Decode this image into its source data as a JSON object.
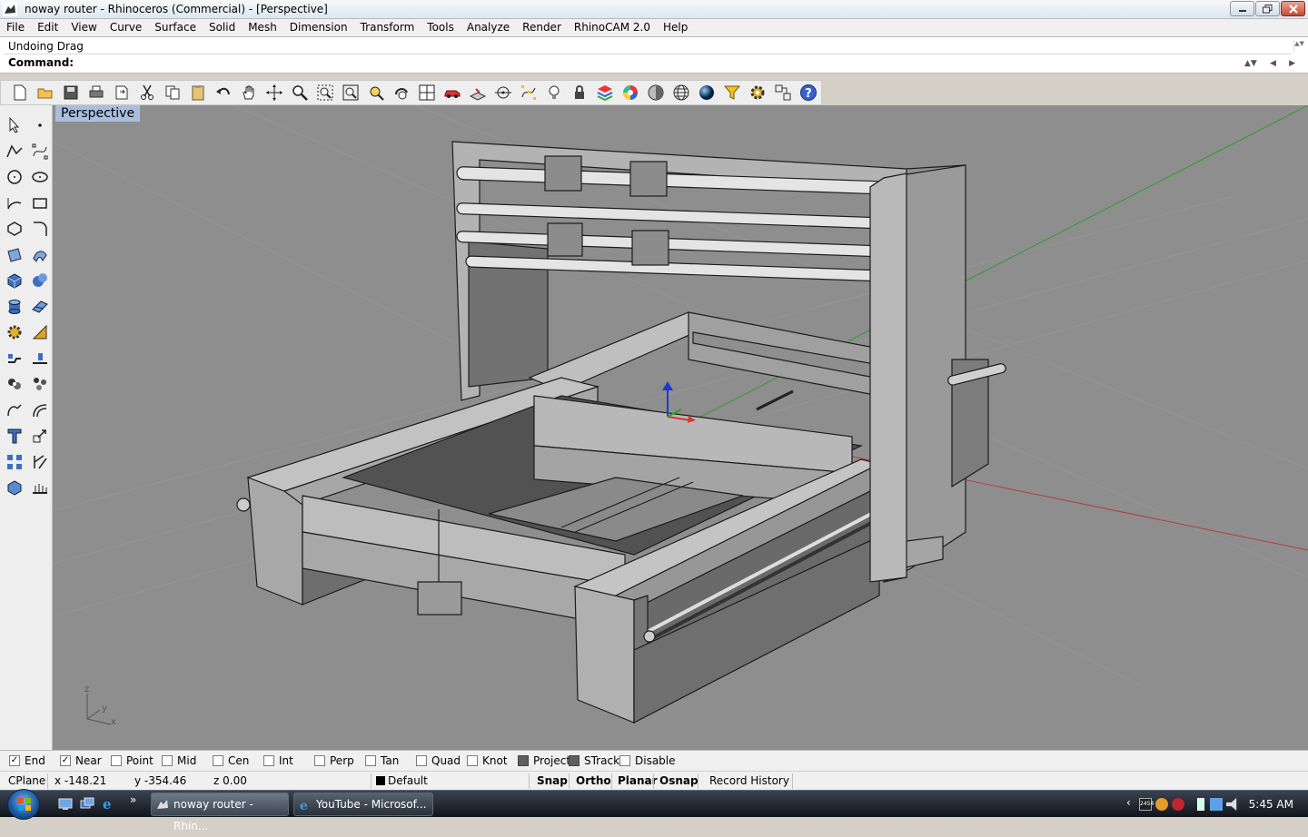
{
  "window": {
    "title": "noway router - Rhinoceros (Commercial) - [Perspective]"
  },
  "menu": [
    "File",
    "Edit",
    "View",
    "Curve",
    "Surface",
    "Solid",
    "Mesh",
    "Dimension",
    "Transform",
    "Tools",
    "Analyze",
    "Render",
    "RhinoCAM 2.0",
    "Help"
  ],
  "command": {
    "history": "Undoing Drag",
    "prompt": "Command:"
  },
  "toolbar_icons": [
    "new-icon",
    "open-icon",
    "save-icon",
    "print-icon",
    "import-icon",
    "cut-icon",
    "copy-icon",
    "paste-icon",
    "undo-icon",
    "pan-icon",
    "rotate-view-icon",
    "zoom-icon",
    "zoom-window-icon",
    "zoom-extents-icon",
    "zoom-selected-icon",
    "undo-view-icon",
    "four-viewports-icon",
    "car-icon",
    "grid-options-icon",
    "object-snap-icon",
    "points-on-icon",
    "lights-icon",
    "lock-icon",
    "layer-icon",
    "color-wheel-icon",
    "shade-icon",
    "wireframe-sphere-icon",
    "render-sphere-icon",
    "select-filter-icon",
    "options-gear-icon",
    "layout-icon",
    "help-icon"
  ],
  "viewport": {
    "label": "Perspective",
    "axis_labels": {
      "z": "z",
      "y": "y",
      "x": "x"
    }
  },
  "osnap": [
    {
      "label": "End",
      "checked": true
    },
    {
      "label": "Near",
      "checked": true
    },
    {
      "label": "Point",
      "checked": false
    },
    {
      "label": "Mid",
      "checked": false
    },
    {
      "label": "Cen",
      "checked": false
    },
    {
      "label": "Int",
      "checked": false
    },
    {
      "label": "Perp",
      "checked": false
    },
    {
      "label": "Tan",
      "checked": false
    },
    {
      "label": "Quad",
      "checked": false
    },
    {
      "label": "Knot",
      "checked": false
    },
    {
      "label": "Project",
      "checked": false
    },
    {
      "label": "STrack",
      "checked": false
    },
    {
      "label": "Disable",
      "checked": false
    }
  ],
  "status": {
    "cplane": "CPlane",
    "x": "x -148.21",
    "y": "y -354.46",
    "z": "z 0.00",
    "layer": "Default",
    "snap": "Snap",
    "ortho": "Ortho",
    "planar": "Planar",
    "osnap": "Osnap",
    "record_history": "Record History"
  },
  "taskbar": {
    "tasks": [
      {
        "label": "noway router - Rhin...",
        "active": true
      },
      {
        "label": "YouTube - Microsof...",
        "active": false
      }
    ],
    "clock": "5:45 AM",
    "tray_badge": "2454"
  },
  "colors": {
    "viewport_bg": "#8e8e8e",
    "viewport_label_bg": "#a9bedf",
    "x_axis": "#b83a3a",
    "y_axis": "#2e9e2e",
    "gizmo_z": "#1a3bd1"
  }
}
